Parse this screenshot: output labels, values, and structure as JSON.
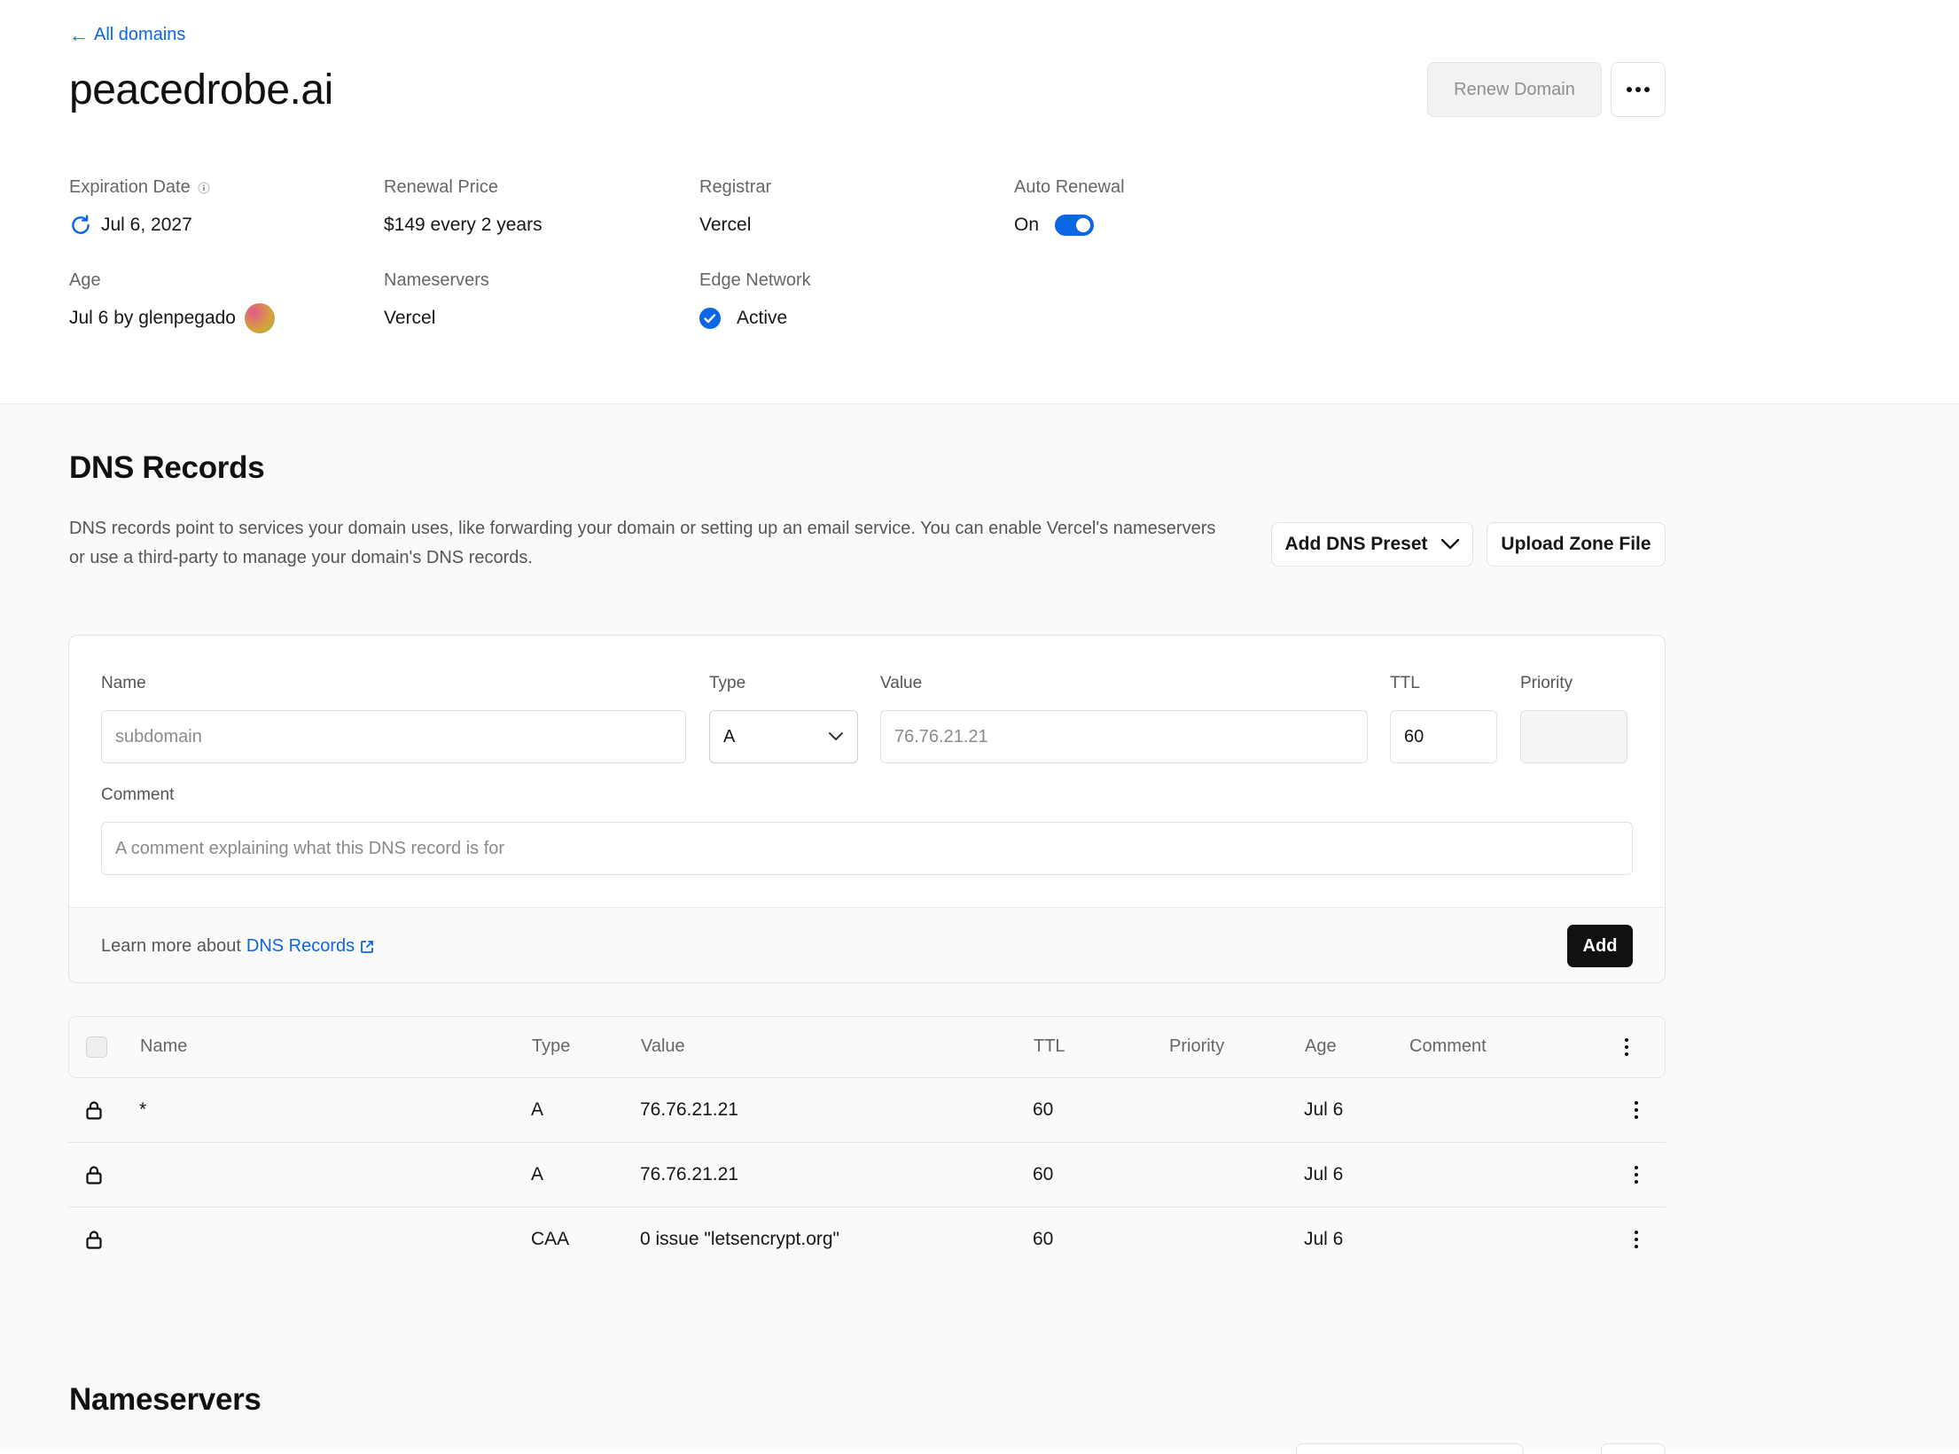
{
  "header": {
    "back_link": "All domains",
    "back_arrow": "←",
    "domain": "peacedrobe.ai",
    "renew_button": "Renew Domain"
  },
  "info": {
    "expiration": {
      "label": "Expiration Date",
      "value": "Jul 6, 2027"
    },
    "renewal_price": {
      "label": "Renewal Price",
      "value": "$149 every 2 years"
    },
    "registrar": {
      "label": "Registrar",
      "value": "Vercel"
    },
    "auto_renewal": {
      "label": "Auto Renewal",
      "value": "On",
      "enabled": true
    },
    "age": {
      "label": "Age",
      "value": "Jul 6 by glenpegado"
    },
    "nameservers": {
      "label": "Nameservers",
      "value": "Vercel"
    },
    "edge_network": {
      "label": "Edge Network",
      "value": "Active"
    }
  },
  "dns": {
    "title": "DNS Records",
    "description": "DNS records point to services your domain uses, like forwarding your domain or setting up an email service. You can enable Vercel's nameservers or use a third-party to manage your domain's DNS records.",
    "preset_button": "Add DNS Preset",
    "upload_button": "Upload Zone File",
    "form": {
      "name_label": "Name",
      "name_placeholder": "subdomain",
      "type_label": "Type",
      "type_value": "A",
      "value_label": "Value",
      "value_placeholder": "76.76.21.21",
      "ttl_label": "TTL",
      "ttl_value": "60",
      "priority_label": "Priority",
      "comment_label": "Comment",
      "comment_placeholder": "A comment explaining what this DNS record is for",
      "learn_prefix": "Learn more about",
      "learn_link": "DNS Records",
      "add_button": "Add"
    },
    "table": {
      "columns": {
        "name": "Name",
        "type": "Type",
        "value": "Value",
        "ttl": "TTL",
        "priority": "Priority",
        "age": "Age",
        "comment": "Comment"
      },
      "rows": [
        {
          "name": "*",
          "type": "A",
          "value": "76.76.21.21",
          "ttl": "60",
          "priority": "",
          "age": "Jul 6",
          "comment": ""
        },
        {
          "name": "",
          "type": "A",
          "value": "76.76.21.21",
          "ttl": "60",
          "priority": "",
          "age": "Jul 6",
          "comment": ""
        },
        {
          "name": "",
          "type": "CAA",
          "value": "0 issue \"letsencrypt.org\"",
          "ttl": "60",
          "priority": "",
          "age": "Jul 6",
          "comment": ""
        }
      ]
    }
  },
  "nameservers_section": {
    "title": "Nameservers"
  },
  "icons": {
    "info": "info-icon",
    "refresh": "refresh-icon",
    "check": "check-circle-icon",
    "lock": "lock-icon",
    "chevron": "chevron-down-icon",
    "external": "external-link-icon",
    "more": "more-horizontal-icon",
    "kebab": "more-vertical-icon"
  },
  "colors": {
    "accent": "#0a66e4",
    "primary_button": "#111111"
  }
}
